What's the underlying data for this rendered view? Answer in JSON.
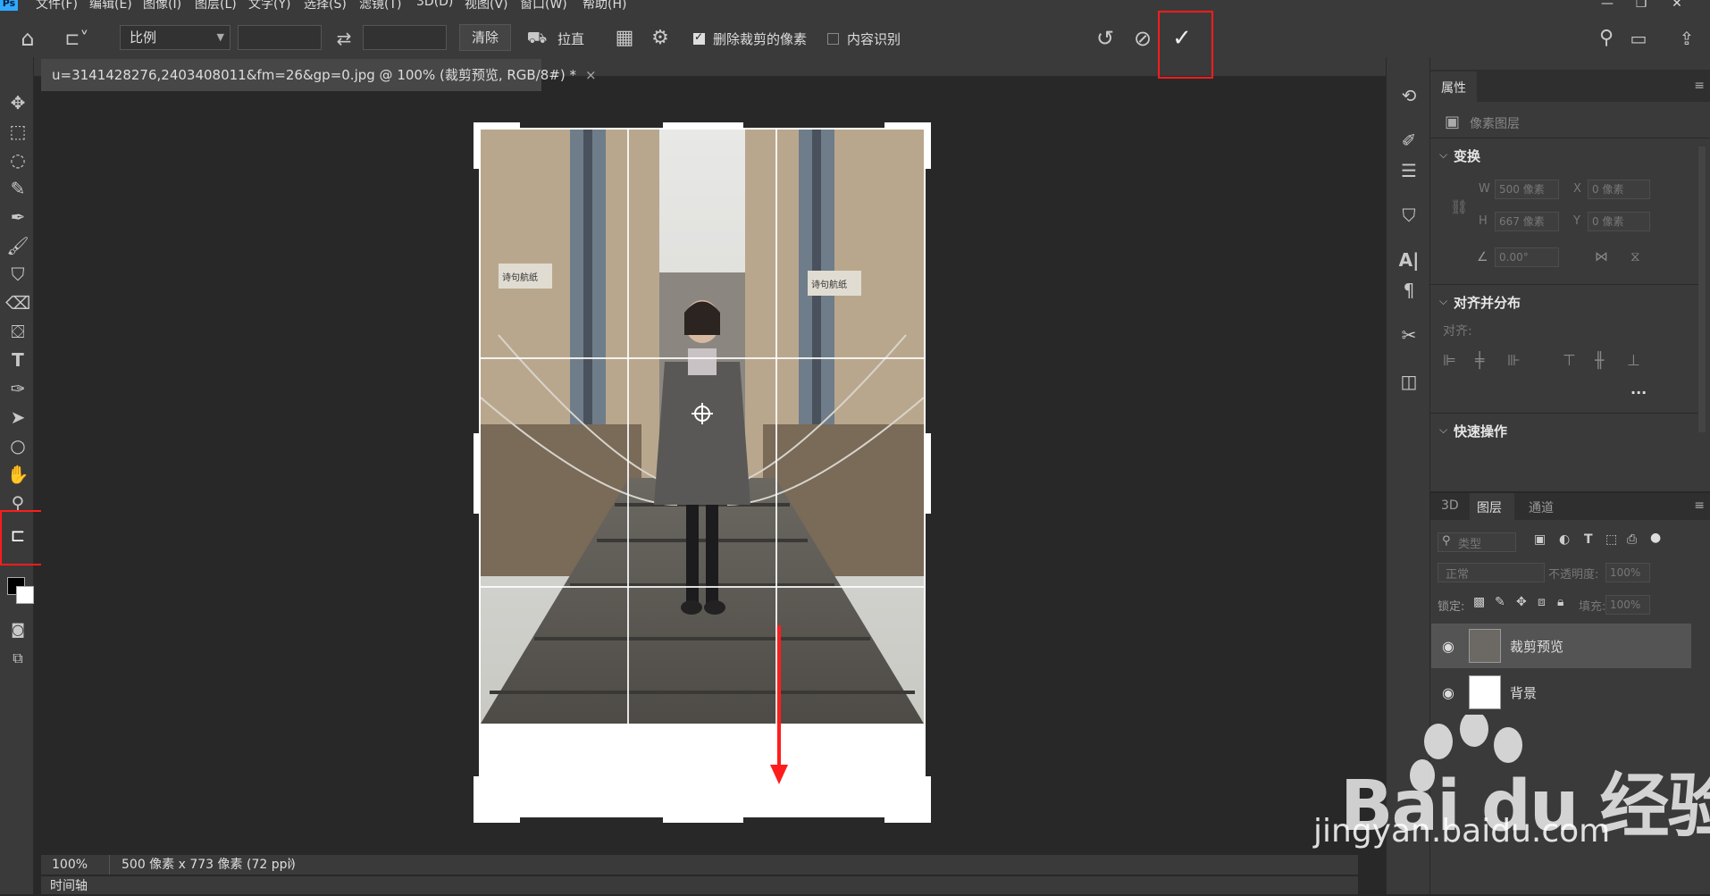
{
  "app": {
    "logo": "Ps"
  },
  "menu": [
    "文件(F)",
    "编辑(E)",
    "图像(I)",
    "图层(L)",
    "文字(Y)",
    "选择(S)",
    "滤镜(T)",
    "3D(D)",
    "视图(V)",
    "窗口(W)",
    "帮助(H)"
  ],
  "options": {
    "ratio_label": "比例",
    "ratio_w": "",
    "ratio_h": "",
    "clear_label": "清除",
    "straighten_label": "拉直",
    "delete_cropped_label": "删除裁剪的像素",
    "delete_cropped_checked": true,
    "content_aware_label": "内容识别",
    "content_aware_checked": false
  },
  "document": {
    "tab_title": "u=3141428276,2403408011&fm=26&gp=0.jpg @ 100% (裁剪预览, RGB/8#) *",
    "close_glyph": "×"
  },
  "photo_signs": [
    "诗句航纸",
    "诗句航纸"
  ],
  "status": {
    "zoom": "100%",
    "doc_info": "500 像素 x 773 像素 (72 ppi)",
    "arrow": "〉"
  },
  "timeline_label": "时间轴",
  "properties": {
    "tab": "属性",
    "layer_type": "像素图层",
    "transform_title": "变换",
    "w_label": "W",
    "w_value": "500 像素",
    "h_label": "H",
    "h_value": "667 像素",
    "x_label": "X",
    "x_value": "0 像素",
    "y_label": "Y",
    "y_value": "0 像素",
    "angle_value": "0.00°",
    "align_title": "对齐并分布",
    "align_label": "对齐:",
    "quick_title": "快速操作",
    "more": "..."
  },
  "layers_panel": {
    "tabs": [
      "3D",
      "图层",
      "通道"
    ],
    "active_tab": "图层",
    "filter_label": "类型",
    "blend_mode": "正常",
    "opacity_label": "不透明度:",
    "opacity_value": "100%",
    "lock_label": "锁定:",
    "fill_label": "填充:",
    "fill_value": "100%",
    "layers": [
      {
        "name": "裁剪预览",
        "selected": true
      },
      {
        "name": "背景",
        "selected": false
      }
    ]
  },
  "watermark": {
    "line1": "Bai du 经验",
    "line2": "jingyan.baidu.com"
  },
  "colors": {
    "highlight": "#ff1c1c",
    "panel": "#3a3a3a",
    "canvas": "#282828"
  }
}
